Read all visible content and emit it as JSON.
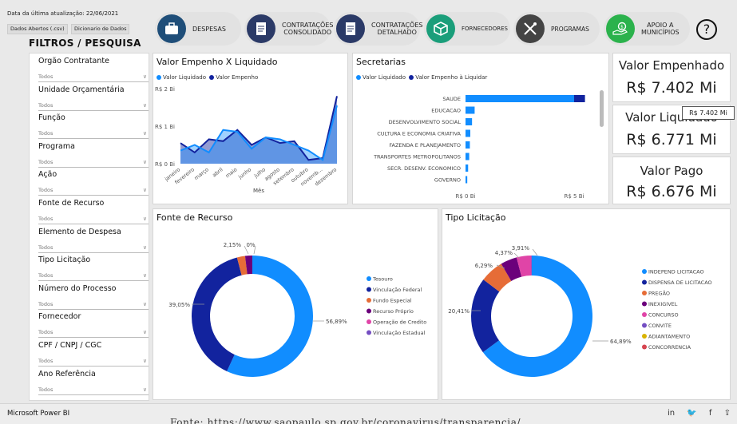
{
  "header": {
    "updated": "Data da última atualização: 22/06/2021",
    "btn_csv": "Dados Abertos (.csv)",
    "btn_dict": "Dicionario de Dados",
    "filters_title": "FILTROS / PESQUISA"
  },
  "nav": {
    "despesas": "DESPESAS",
    "contrat_cons_1": "CONTRATAÇÕES",
    "contrat_cons_2": "CONSOLIDADO",
    "contrat_det_1": "CONTRATAÇÕES",
    "contrat_det_2": "DETALHADO",
    "fornecedores": "FORNECEDORES",
    "programas": "PROGRAMAS",
    "apoio_1": "APOIO A",
    "apoio_2": "MUNICÍPIOS",
    "help": "?"
  },
  "filters": [
    {
      "label": "Orgão Contratante",
      "value": "Todos"
    },
    {
      "label": "Unidade Orçamentária",
      "value": "Todos"
    },
    {
      "label": "Função",
      "value": "Todos"
    },
    {
      "label": "Programa",
      "value": "Todos"
    },
    {
      "label": "Ação",
      "value": "Todos"
    },
    {
      "label": "Fonte de Recurso",
      "value": "Todos"
    },
    {
      "label": "Elemento de Despesa",
      "value": "Todos"
    },
    {
      "label": "Tipo Licitação",
      "value": "Todos"
    },
    {
      "label": "Número do Processo",
      "value": "Todos"
    },
    {
      "label": "Fornecedor",
      "value": "Todos"
    },
    {
      "label": "CPF / CNPJ / CGC",
      "value": "Todos"
    },
    {
      "label": "Ano Referência",
      "value": "Todos"
    }
  ],
  "kpis": {
    "empenhado_label": "Valor Empenhado",
    "empenhado_value": "R$ 7.402 Mi",
    "liquidado_label": "Valor Liquidado",
    "liquidado_value": "R$ 6.771 Mi",
    "pago_label": "Valor Pago",
    "pago_value": "R$ 6.676 Mi",
    "tooltip": "R$ 7.402 Mi"
  },
  "panels": {
    "line_title": "Valor Empenho X Liquidado",
    "secretarias_title": "Secretarias",
    "fonte_title": "Fonte de Recurso",
    "tipo_title": "Tipo Licitação"
  },
  "colors": {
    "light_blue": "#118DFF",
    "dark_blue": "#12239E",
    "orange": "#E66C37",
    "purple": "#6B007B",
    "pink": "#E044A7",
    "violet": "#744EC2",
    "yellow": "#D9B300",
    "red": "#D64550"
  },
  "chart_data": [
    {
      "type": "area",
      "title": "Valor Empenho X Liquidado",
      "xlabel": "Mês",
      "ylabel": "",
      "ylim": [
        0,
        2
      ],
      "y_ticks": [
        "R$ 0 Bi",
        "R$ 1 Bi",
        "R$ 2 Bi"
      ],
      "categories": [
        "janeiro",
        "fevereiro",
        "março",
        "abril",
        "maio",
        "junho",
        "julho",
        "agosto",
        "setembro",
        "outubro",
        "novemb...",
        "dezembro"
      ],
      "series": [
        {
          "name": "Valor Liquidado",
          "values": [
            0.35,
            0.5,
            0.3,
            0.9,
            0.85,
            0.4,
            0.7,
            0.65,
            0.5,
            0.35,
            0.1,
            1.55
          ]
        },
        {
          "name": "Valor Empenho",
          "values": [
            0.55,
            0.3,
            0.65,
            0.6,
            0.9,
            0.5,
            0.7,
            0.55,
            0.6,
            0.1,
            0.15,
            1.8
          ]
        }
      ]
    },
    {
      "type": "bar",
      "orientation": "horizontal",
      "title": "Secretarias",
      "categories": [
        "SAUDE",
        "EDUCACAO",
        "DESENVOLVIMENTO SOCIAL",
        "CULTURA E ECONOMIA CRIATIVA",
        "FAZENDA E PLANEJAMENTO",
        "TRANSPORTES METROPOLITANOS",
        "SECR. DESENV. ECONOMICO",
        "GOVERNO"
      ],
      "x_ticks": [
        "R$ 0 Bi",
        "R$ 5 Bi"
      ],
      "xlim": [
        0,
        5
      ],
      "series": [
        {
          "name": "Valor Liquidado",
          "values": [
            5.0,
            0.42,
            0.3,
            0.22,
            0.2,
            0.17,
            0.12,
            0.08
          ]
        },
        {
          "name": "Valor Empenho à Liquidar",
          "values": [
            0.5,
            0.0,
            0.0,
            0.0,
            0.0,
            0.0,
            0.0,
            0.0
          ]
        }
      ]
    },
    {
      "type": "pie",
      "title": "Fonte de Recurso",
      "labels": [
        "Tesouro",
        "Vinculação Federal",
        "Fundo Especial",
        "Recurso Próprio",
        "Operação de Credito",
        "Vinculação Estadual"
      ],
      "values": [
        56.89,
        39.05,
        2.15,
        1.91,
        0.0,
        0.0
      ],
      "data_labels": [
        "56,89%",
        "39,05%",
        "2,15%",
        "0%"
      ]
    },
    {
      "type": "pie",
      "title": "Tipo Licitação",
      "labels": [
        "INDEPEND LICITACAO",
        "DISPENSA DE LICITACAO",
        "PREGÃO",
        "INEXIGIVEL",
        "CONCURSO",
        "CONVITE",
        "ADIANTAMENTO",
        "CONCORRENCIA"
      ],
      "values": [
        64.89,
        20.41,
        6.29,
        4.37,
        3.91,
        0.13,
        0.0,
        0.0
      ],
      "data_labels": [
        "64,89%",
        "20,41%",
        "6,29%",
        "4,37%",
        "3,91%"
      ]
    }
  ],
  "footer": {
    "app": "Microsoft Power BI",
    "source": "Fonte: https://www.saopaulo.sp.gov.br/coronavirus/transparencia/"
  }
}
